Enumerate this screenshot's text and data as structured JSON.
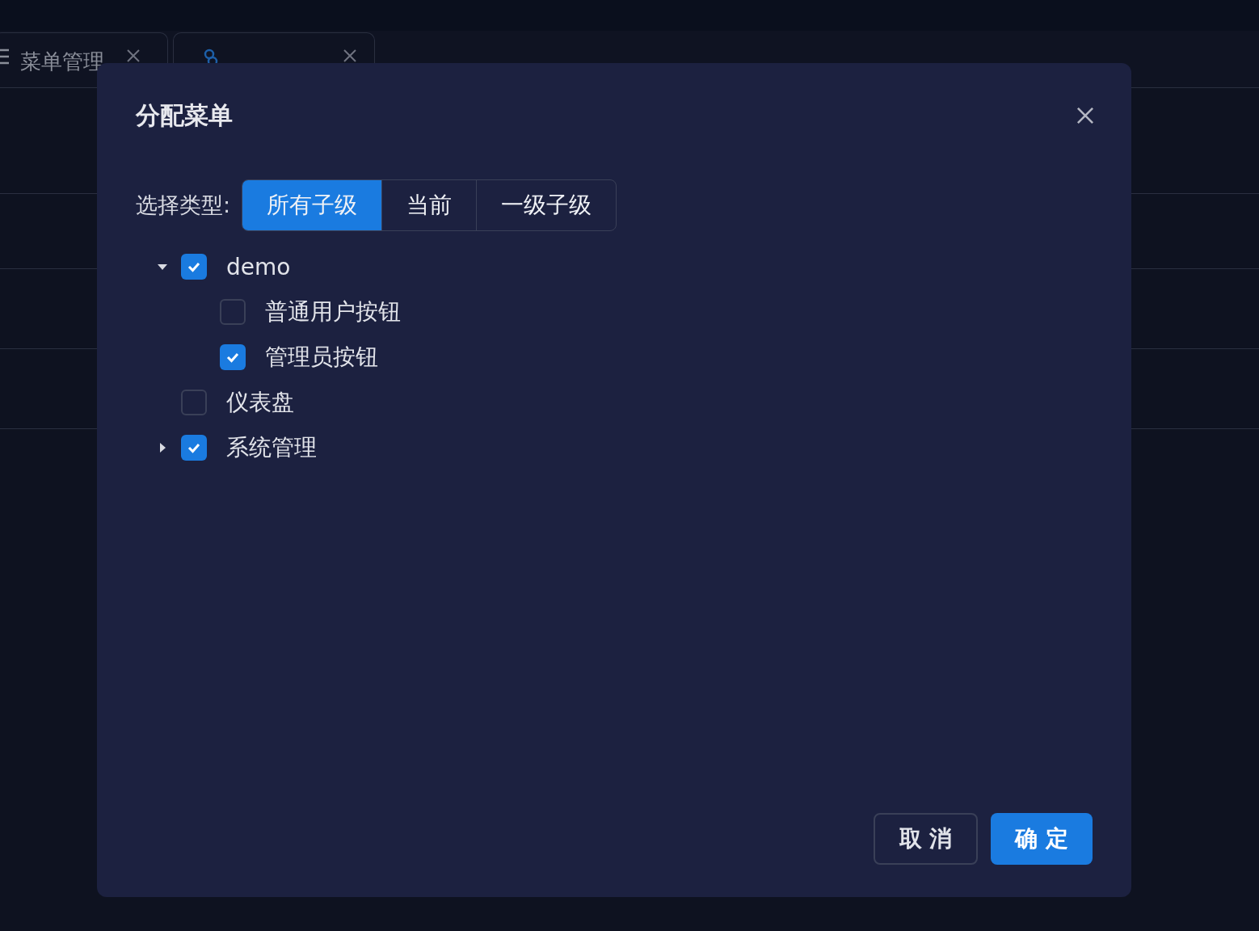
{
  "page_tabs": [
    {
      "label": "菜单管理",
      "selected": false
    },
    {
      "selected": true
    }
  ],
  "dialog": {
    "title": "分配菜单",
    "type_label": "选择类型:",
    "type_options": [
      {
        "label": "所有子级",
        "selected": true
      },
      {
        "label": "当前",
        "selected": false
      },
      {
        "label": "一级子级",
        "selected": false
      }
    ],
    "tree": [
      {
        "label": "demo",
        "kind": "branch",
        "expanded": true,
        "checked": true,
        "children": [
          {
            "label": "普通用户按钮",
            "kind": "leaf",
            "checked": false
          },
          {
            "label": "管理员按钮",
            "kind": "leaf",
            "checked": true
          }
        ]
      },
      {
        "label": "仪表盘",
        "kind": "leaf",
        "checked": false
      },
      {
        "label": "系统管理",
        "kind": "branch",
        "expanded": false,
        "checked": true
      }
    ],
    "buttons": [
      {
        "label": "取 消",
        "kind": "default"
      },
      {
        "label": "确 定",
        "kind": "primary"
      }
    ]
  }
}
